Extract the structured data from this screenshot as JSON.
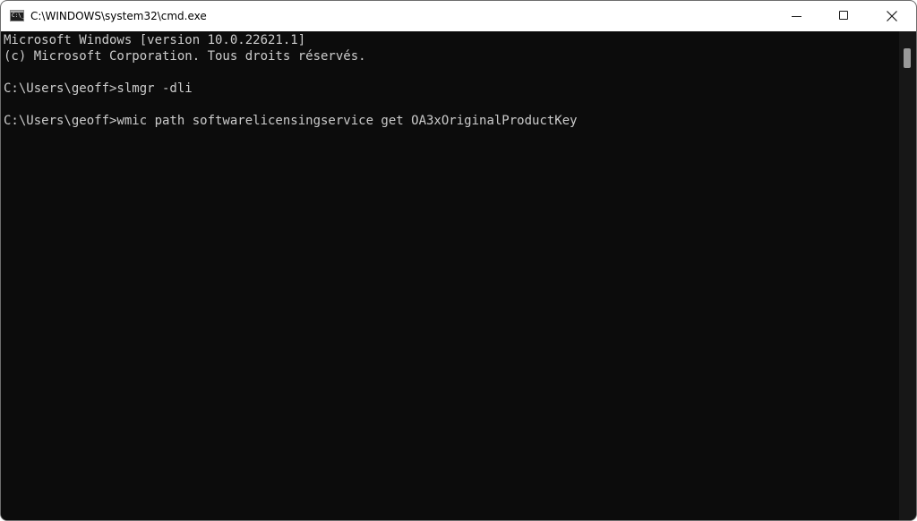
{
  "window": {
    "title": "C:\\WINDOWS\\system32\\cmd.exe",
    "icon": "cmd-icon",
    "icon_glyph": "C:\\_",
    "controls": [
      "minimize-icon",
      "maximize-icon",
      "close-icon"
    ]
  },
  "console": {
    "lines": [
      "Microsoft Windows [version 10.0.22621.1]",
      "(c) Microsoft Corporation. Tous droits réservés.",
      "",
      "C:\\Users\\geoff>slmgr -dli",
      "",
      "C:\\Users\\geoff>wmic path softwarelicensingservice get OA3xOriginalProductKey"
    ]
  },
  "colors": {
    "console_background": "#0c0c0c",
    "console_text": "#cccccc",
    "titlebar": "#ffffff"
  }
}
